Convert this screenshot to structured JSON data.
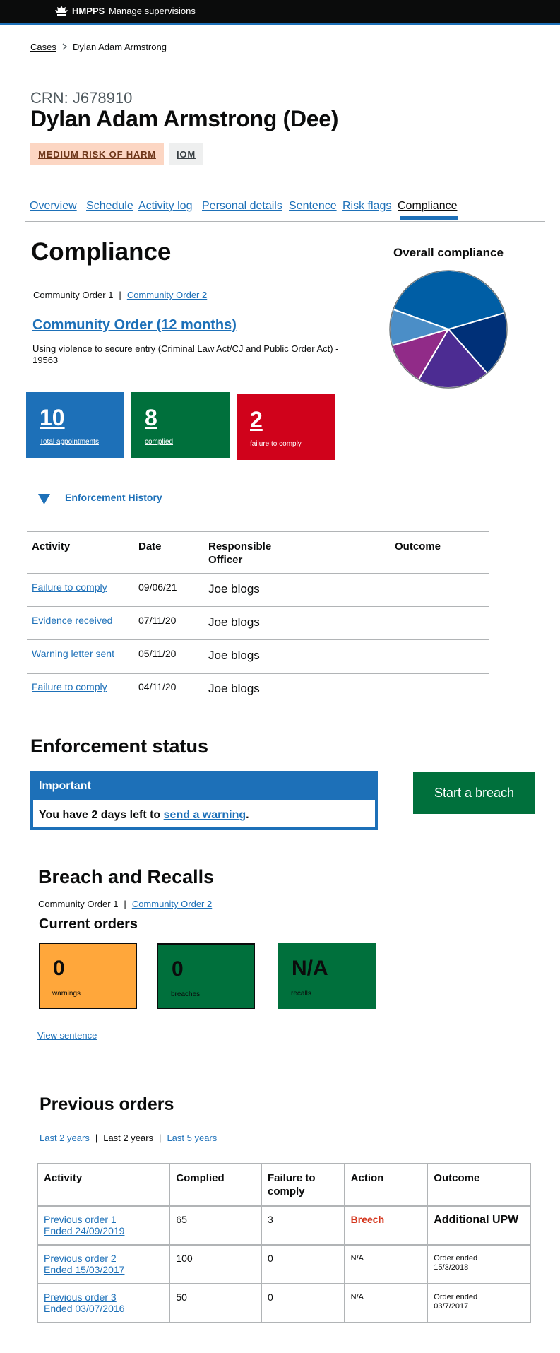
{
  "header": {
    "brand": "HMPPS",
    "service": "Manage supervisions"
  },
  "breadcrumb": {
    "root": "Cases",
    "current": "Dylan Adam Armstrong"
  },
  "person": {
    "crn": "CRN: J678910",
    "name": "Dylan Adam Armstrong (Dee)",
    "risk_tag": "MEDIUM RISK OF HARM",
    "iom_tag": "IOM"
  },
  "tabs": [
    {
      "label": "Overview"
    },
    {
      "label": "Schedule"
    },
    {
      "label": "Activity log"
    },
    {
      "label": "Personal details"
    },
    {
      "label": "Sentence"
    },
    {
      "label": "Risk flags"
    },
    {
      "label": "Compliance",
      "active": true
    }
  ],
  "compliance": {
    "heading": "Compliance",
    "order_current": "Community Order 1",
    "order_other": "Community Order 2",
    "order_title": "Community Order (12 months)",
    "offence": "Using violence to secure entry (Criminal Law Act/CJ and Public Order Act) - 19563",
    "overall_title": "Overall compliance",
    "colors": {
      "blue": "#1d70b8",
      "green": "#00703c",
      "red": "#d4351c"
    },
    "stats": [
      {
        "value": "10",
        "label": "Total appointments",
        "color": "#1d70b8"
      },
      {
        "value": "8",
        "label": "complied",
        "color": "#00703c"
      },
      {
        "value": "2",
        "label": "failure to comply",
        "color": "#d0021b"
      }
    ]
  },
  "chart_data": {
    "type": "pie",
    "title": "Overall compliance",
    "slices": [
      {
        "value": 40,
        "color": "#005ea5"
      },
      {
        "value": 18,
        "color": "#003078"
      },
      {
        "value": 20,
        "color": "#4c2c92"
      },
      {
        "value": 12,
        "color": "#912b88"
      },
      {
        "value": 10,
        "color": "#4b8ec7"
      }
    ]
  },
  "enforcement": {
    "toggle_label": "Enforcement History",
    "columns": [
      "Activity",
      "Date",
      "Responsible Officer",
      "Outcome"
    ],
    "rows": [
      {
        "activity": "Failure to comply",
        "date": "09/06/21",
        "officer": "Joe blogs"
      },
      {
        "activity": "Evidence received",
        "date": "07/11/20",
        "officer": "Joe blogs"
      },
      {
        "activity": "Warning letter sent",
        "date": "05/11/20",
        "officer": "Joe blogs"
      },
      {
        "activity": "Failure to comply",
        "date": "04/11/20",
        "officer": "Joe blogs"
      }
    ]
  },
  "status": {
    "heading": "Enforcement status",
    "important_title": "Important",
    "message_prefix": "You have 2 days left to",
    "message_link": "send a warning",
    "message_suffix": ".",
    "breach_button": "Start a breach"
  },
  "breach": {
    "heading": "Breach and Recalls",
    "order_current": "Community Order 1",
    "order_other": "Community Order 2",
    "current_heading": "Current orders",
    "boxes": [
      {
        "value": "0",
        "label": "warnings",
        "color": "#ffa73b"
      },
      {
        "value": "0",
        "label": "breaches",
        "color": "#00703c"
      },
      {
        "value": "N/A",
        "label": "recalls",
        "color": "#00703c"
      }
    ],
    "view_sentence": "View sentence"
  },
  "previous": {
    "heading": "Previous orders",
    "filters": [
      "Last 2 years",
      "Last 2 years",
      "Last 5 years"
    ],
    "columns": [
      "Activity",
      "Complied",
      "Failure to comply",
      "Action",
      "Outcome"
    ],
    "rows": [
      {
        "order": "Previous order 1",
        "ended": "Ended 24/09/2019",
        "complied": "65",
        "failure": "3",
        "action": "Breech",
        "outcome": "Additional UPW"
      },
      {
        "order": "Previous order 2",
        "ended": "Ended 15/03/2017",
        "complied": "100",
        "failure": "0",
        "action": "N/A",
        "outcome": "Order ended 15/3/2018"
      },
      {
        "order": "Previous order 3",
        "ended": "Ended 03/07/2016",
        "complied": "50",
        "failure": "0",
        "action": "N/A",
        "outcome": "Order ended 03/7/2017"
      }
    ]
  }
}
